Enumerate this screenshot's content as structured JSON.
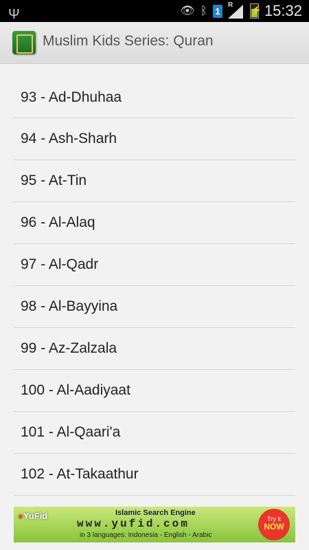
{
  "status_bar": {
    "time": "15:32",
    "sim_slot": "1",
    "roaming": "R",
    "icons": [
      "usb-icon",
      "eye-icon",
      "bluetooth-icon",
      "sim-icon",
      "signal-icon",
      "battery-charging-icon"
    ]
  },
  "action_bar": {
    "title": "Muslim Kids Series: Quran",
    "icon": "quran-book-icon"
  },
  "surahs": [
    "93 - Ad-Dhuhaa",
    "94 - Ash-Sharh",
    "95 - At-Tin",
    "96 - Al-Alaq",
    "97 - Al-Qadr",
    "98 - Al-Bayyina",
    "99 - Az-Zalzala",
    "100 - Al-Aadiyaat",
    "101 - Al-Qaari'a",
    "102 - At-Takaathur"
  ],
  "ad": {
    "brand": "YuFid",
    "engine": "Islamic Search Engine",
    "url": "www.yufid.com",
    "languages": "in 3 languages: Indonesia - English - Arabic",
    "cta_line1": "Try it",
    "cta_line2": "NOW"
  },
  "colors": {
    "status_bar_bg": "#000000",
    "action_bar_bg": "#e4e4e4",
    "list_bg": "#f2f2f2",
    "divider": "#d6d6d6",
    "ad_green": "#88c43a"
  }
}
